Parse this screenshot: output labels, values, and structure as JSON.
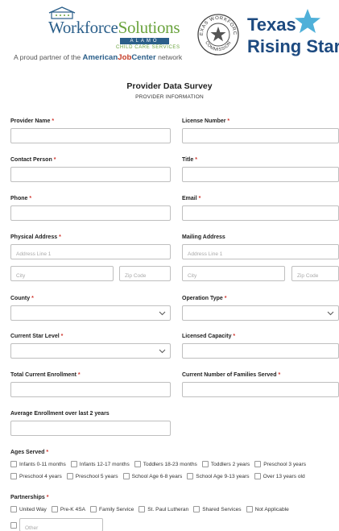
{
  "header": {
    "ws_name_part1": "Workforce",
    "ws_name_part2": "Solutions",
    "ws_region": "ALAMO",
    "ws_tagline": "CHILD CARE SERVICES",
    "partner_prefix": "A proud partner of the ",
    "partner_brand_1": "American",
    "partner_brand_2": "Job",
    "partner_brand_3": "Center",
    "partner_suffix": "network",
    "seal_text_top": "TEXAS WORKFORCE",
    "seal_text_bottom": "COMMISSION",
    "trs_line1": "Texas",
    "trs_line2": "Rising Star"
  },
  "form": {
    "title": "Provider Data Survey",
    "section": "PROVIDER INFORMATION",
    "required_mark": "*",
    "fields": {
      "provider_name": "Provider Name",
      "license_number": "License Number",
      "contact_person": "Contact Person",
      "title": "Title",
      "phone": "Phone",
      "email": "Email",
      "physical_address": "Physical Address",
      "mailing_address": "Mailing Address",
      "county": "County",
      "operation_type": "Operation Type",
      "current_star_level": "Current Star Level",
      "licensed_capacity": "Licensed Capacity",
      "total_current_enrollment": "Total Current Enrollment",
      "current_families_served": "Current Number of Families Served",
      "average_enrollment": "Average Enrollment over last 2 years",
      "ages_served": "Ages Served",
      "partnerships": "Partnerships"
    },
    "placeholders": {
      "address_line_1": "Address Line 1",
      "city": "City",
      "zip": "Zip Code",
      "other": "Other"
    },
    "ages_row1": [
      "Infants 0-11 months",
      "Infants 12-17 months",
      "Toddlers 18-23 months",
      "Toddlers 2 years",
      "Preschool 3 years"
    ],
    "ages_row2": [
      "Preschool 4 years",
      "Preschool 5 years",
      "School Age 6-8 years",
      "School Age 9-13 years",
      "Over 13 years old"
    ],
    "partnerships": [
      "United Way",
      "Pre-K 4SA",
      "Family Service",
      "St. Paul Lutheran",
      "Shared Services",
      "Not Applicable"
    ]
  },
  "colors": {
    "required": "#d0342c",
    "ws_blue": "#2b5f8a",
    "ws_green": "#6aa33d",
    "trs_navy": "#1d4a80",
    "trs_star": "#4fb0d9",
    "border": "#bfbfbf"
  }
}
